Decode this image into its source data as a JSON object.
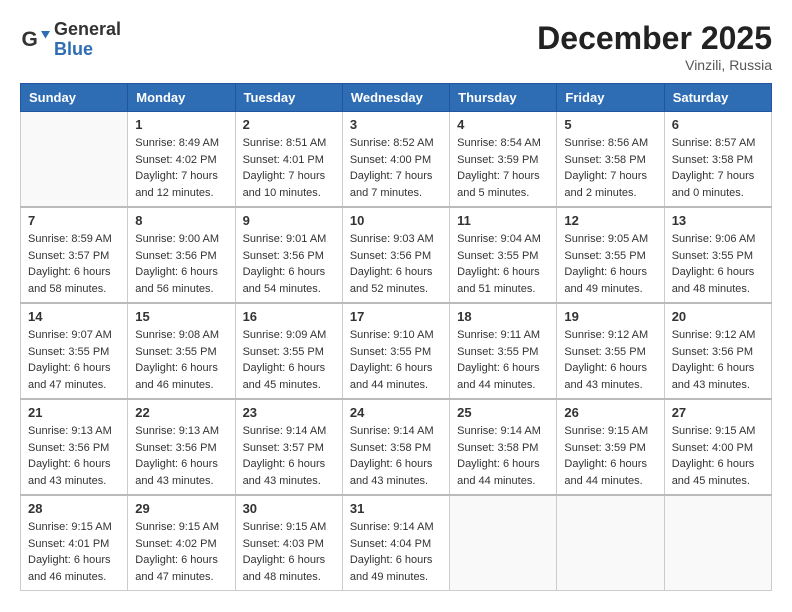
{
  "header": {
    "logo_general": "General",
    "logo_blue": "Blue",
    "month_title": "December 2025",
    "location": "Vinzili, Russia"
  },
  "weekdays": [
    "Sunday",
    "Monday",
    "Tuesday",
    "Wednesday",
    "Thursday",
    "Friday",
    "Saturday"
  ],
  "weeks": [
    [
      {
        "day": "",
        "info": ""
      },
      {
        "day": "1",
        "info": "Sunrise: 8:49 AM\nSunset: 4:02 PM\nDaylight: 7 hours\nand 12 minutes."
      },
      {
        "day": "2",
        "info": "Sunrise: 8:51 AM\nSunset: 4:01 PM\nDaylight: 7 hours\nand 10 minutes."
      },
      {
        "day": "3",
        "info": "Sunrise: 8:52 AM\nSunset: 4:00 PM\nDaylight: 7 hours\nand 7 minutes."
      },
      {
        "day": "4",
        "info": "Sunrise: 8:54 AM\nSunset: 3:59 PM\nDaylight: 7 hours\nand 5 minutes."
      },
      {
        "day": "5",
        "info": "Sunrise: 8:56 AM\nSunset: 3:58 PM\nDaylight: 7 hours\nand 2 minutes."
      },
      {
        "day": "6",
        "info": "Sunrise: 8:57 AM\nSunset: 3:58 PM\nDaylight: 7 hours\nand 0 minutes."
      }
    ],
    [
      {
        "day": "7",
        "info": "Sunrise: 8:59 AM\nSunset: 3:57 PM\nDaylight: 6 hours\nand 58 minutes."
      },
      {
        "day": "8",
        "info": "Sunrise: 9:00 AM\nSunset: 3:56 PM\nDaylight: 6 hours\nand 56 minutes."
      },
      {
        "day": "9",
        "info": "Sunrise: 9:01 AM\nSunset: 3:56 PM\nDaylight: 6 hours\nand 54 minutes."
      },
      {
        "day": "10",
        "info": "Sunrise: 9:03 AM\nSunset: 3:56 PM\nDaylight: 6 hours\nand 52 minutes."
      },
      {
        "day": "11",
        "info": "Sunrise: 9:04 AM\nSunset: 3:55 PM\nDaylight: 6 hours\nand 51 minutes."
      },
      {
        "day": "12",
        "info": "Sunrise: 9:05 AM\nSunset: 3:55 PM\nDaylight: 6 hours\nand 49 minutes."
      },
      {
        "day": "13",
        "info": "Sunrise: 9:06 AM\nSunset: 3:55 PM\nDaylight: 6 hours\nand 48 minutes."
      }
    ],
    [
      {
        "day": "14",
        "info": "Sunrise: 9:07 AM\nSunset: 3:55 PM\nDaylight: 6 hours\nand 47 minutes."
      },
      {
        "day": "15",
        "info": "Sunrise: 9:08 AM\nSunset: 3:55 PM\nDaylight: 6 hours\nand 46 minutes."
      },
      {
        "day": "16",
        "info": "Sunrise: 9:09 AM\nSunset: 3:55 PM\nDaylight: 6 hours\nand 45 minutes."
      },
      {
        "day": "17",
        "info": "Sunrise: 9:10 AM\nSunset: 3:55 PM\nDaylight: 6 hours\nand 44 minutes."
      },
      {
        "day": "18",
        "info": "Sunrise: 9:11 AM\nSunset: 3:55 PM\nDaylight: 6 hours\nand 44 minutes."
      },
      {
        "day": "19",
        "info": "Sunrise: 9:12 AM\nSunset: 3:55 PM\nDaylight: 6 hours\nand 43 minutes."
      },
      {
        "day": "20",
        "info": "Sunrise: 9:12 AM\nSunset: 3:56 PM\nDaylight: 6 hours\nand 43 minutes."
      }
    ],
    [
      {
        "day": "21",
        "info": "Sunrise: 9:13 AM\nSunset: 3:56 PM\nDaylight: 6 hours\nand 43 minutes."
      },
      {
        "day": "22",
        "info": "Sunrise: 9:13 AM\nSunset: 3:56 PM\nDaylight: 6 hours\nand 43 minutes."
      },
      {
        "day": "23",
        "info": "Sunrise: 9:14 AM\nSunset: 3:57 PM\nDaylight: 6 hours\nand 43 minutes."
      },
      {
        "day": "24",
        "info": "Sunrise: 9:14 AM\nSunset: 3:58 PM\nDaylight: 6 hours\nand 43 minutes."
      },
      {
        "day": "25",
        "info": "Sunrise: 9:14 AM\nSunset: 3:58 PM\nDaylight: 6 hours\nand 44 minutes."
      },
      {
        "day": "26",
        "info": "Sunrise: 9:15 AM\nSunset: 3:59 PM\nDaylight: 6 hours\nand 44 minutes."
      },
      {
        "day": "27",
        "info": "Sunrise: 9:15 AM\nSunset: 4:00 PM\nDaylight: 6 hours\nand 45 minutes."
      }
    ],
    [
      {
        "day": "28",
        "info": "Sunrise: 9:15 AM\nSunset: 4:01 PM\nDaylight: 6 hours\nand 46 minutes."
      },
      {
        "day": "29",
        "info": "Sunrise: 9:15 AM\nSunset: 4:02 PM\nDaylight: 6 hours\nand 47 minutes."
      },
      {
        "day": "30",
        "info": "Sunrise: 9:15 AM\nSunset: 4:03 PM\nDaylight: 6 hours\nand 48 minutes."
      },
      {
        "day": "31",
        "info": "Sunrise: 9:14 AM\nSunset: 4:04 PM\nDaylight: 6 hours\nand 49 minutes."
      },
      {
        "day": "",
        "info": ""
      },
      {
        "day": "",
        "info": ""
      },
      {
        "day": "",
        "info": ""
      }
    ]
  ]
}
